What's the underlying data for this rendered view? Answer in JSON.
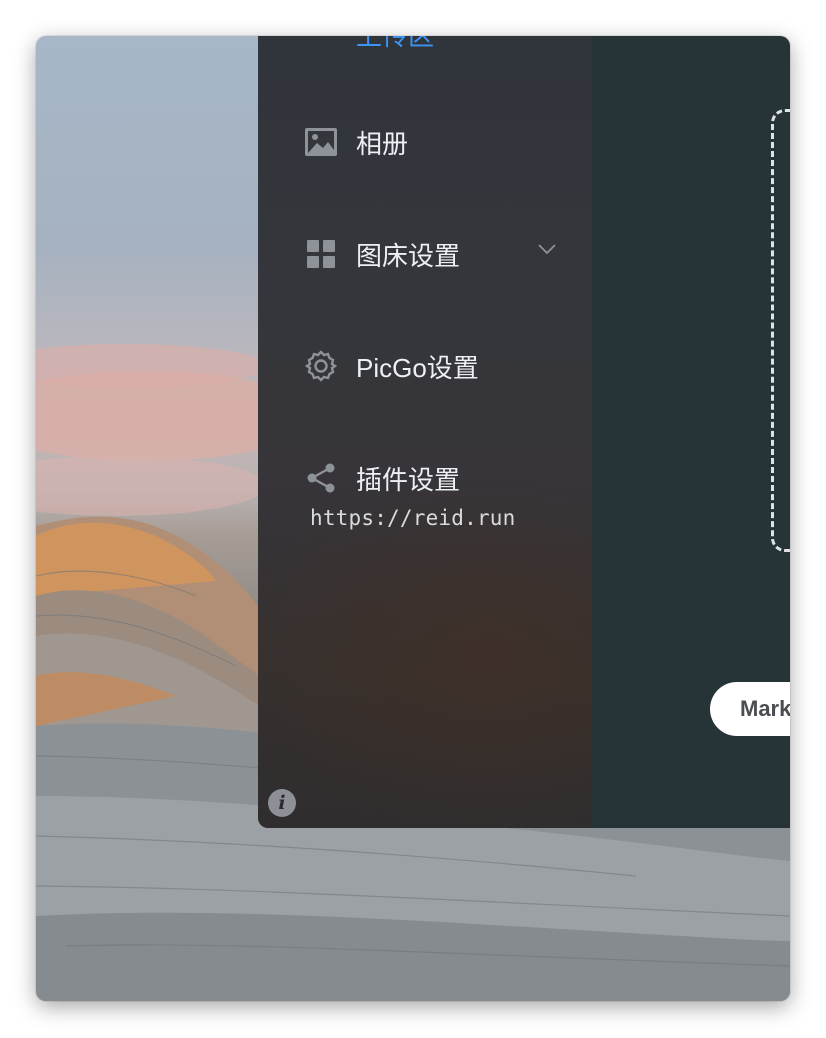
{
  "sidebar": {
    "items": [
      {
        "label": "上传区",
        "icon": "upload-icon",
        "active": true
      },
      {
        "label": "相册",
        "icon": "image-icon"
      },
      {
        "label": "图床设置",
        "icon": "grid-icon",
        "expandable": true
      },
      {
        "label": "PicGo设置",
        "icon": "gear-icon"
      },
      {
        "label": "插件设置",
        "icon": "share-icon"
      }
    ],
    "footer_url": "https://reid.run",
    "info_glyph": "i"
  },
  "main": {
    "link_format_button": "Mark"
  },
  "colors": {
    "accent": "#3d94f5",
    "sidebar_bg": "#33353a",
    "content_bg": "#263337"
  }
}
